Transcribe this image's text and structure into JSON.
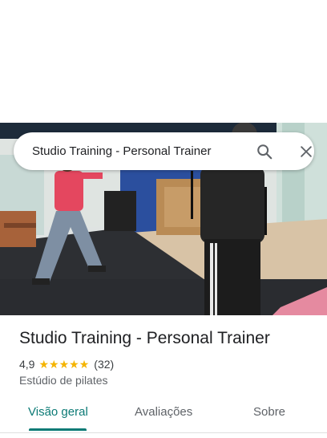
{
  "search": {
    "query": "Studio Training - Personal Trainer",
    "search_icon": "search-icon",
    "close_icon": "close-icon"
  },
  "photo": {
    "description_icon": "place-photo"
  },
  "place": {
    "name": "Studio Training - Personal Trainer",
    "rating": "4,9",
    "stars": 5,
    "review_count": "(32)",
    "category": "Estúdio de pilates"
  },
  "tabs": [
    {
      "label": "Visão geral",
      "active": true
    },
    {
      "label": "Avaliações",
      "active": false
    },
    {
      "label": "Sobre",
      "active": false
    }
  ],
  "colors": {
    "accent": "#0b7a75",
    "star": "#f4b400",
    "text": "#202124",
    "secondary_text": "#5f6368"
  }
}
